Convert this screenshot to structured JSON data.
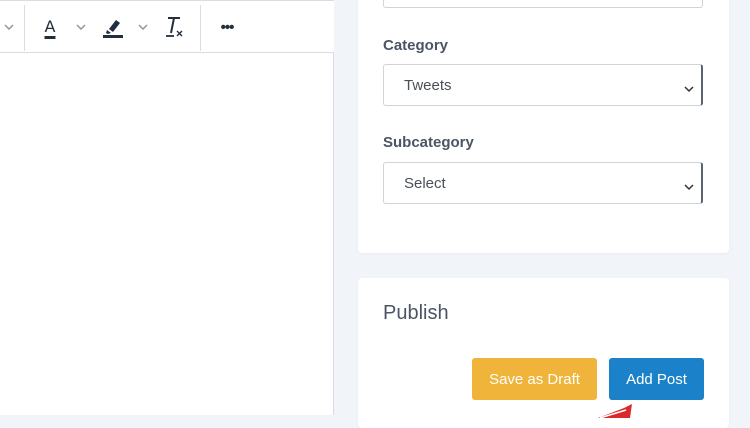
{
  "toolbar": {
    "font_color_letter": "A",
    "more_label": "•••"
  },
  "category": {
    "label": "Category",
    "selected": "Tweets"
  },
  "subcategory": {
    "label": "Subcategory",
    "selected": "Select"
  },
  "publish": {
    "title": "Publish",
    "save_draft_label": "Save as Draft",
    "add_post_label": "Add Post"
  },
  "colors": {
    "draft_button": "#f0b43a",
    "add_button": "#1b82c9",
    "cursor": "#d92b2b"
  },
  "icons": [
    "chevron-down-icon",
    "font-color-icon",
    "highlight-marker-icon",
    "clear-formatting-icon",
    "more-icon"
  ]
}
